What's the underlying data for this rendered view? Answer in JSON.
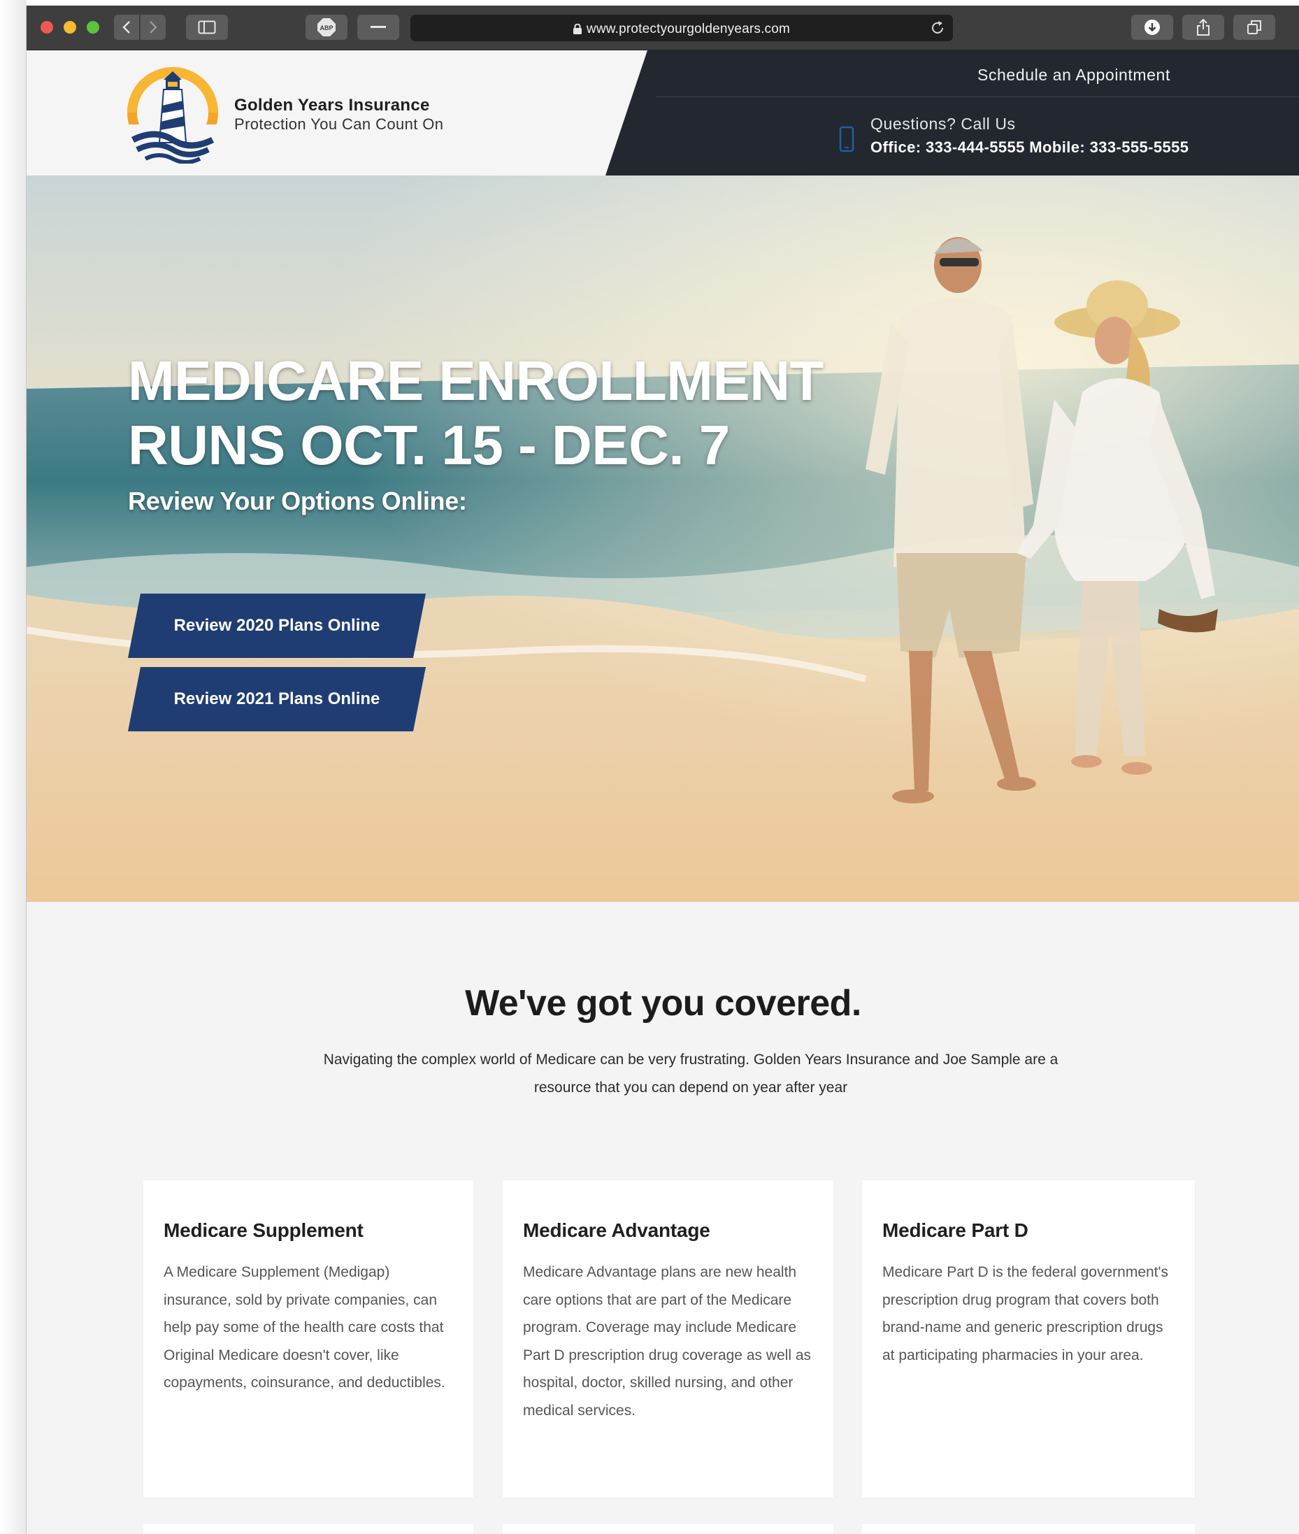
{
  "browser": {
    "url": "www.protectyourgoldenyears.com",
    "abp_label": "ABP"
  },
  "header": {
    "brand_name": "Golden Years Insurance",
    "brand_tagline": "Protection You Can Count On",
    "schedule_link": "Schedule an Appointment",
    "questions_label": "Questions? Call Us",
    "phones": "Office: 333-444-5555 Mobile: 333-555-5555"
  },
  "hero": {
    "title_line1": "MEDICARE ENROLLMENT",
    "title_line2": "RUNS OCT. 15 - DEC. 7",
    "subtitle": "Review Your Options Online:",
    "button_2020": "Review 2020 Plans Online",
    "button_2021": "Review 2021 Plans Online"
  },
  "covered": {
    "title": "We've got you covered.",
    "text": "Navigating the complex world of Medicare can be very frustrating. Golden Years Insurance and Joe Sample are a resource that you can depend on year after year"
  },
  "cards": [
    {
      "title": "Medicare Supplement",
      "text": "A Medicare Supplement (Medigap) insurance, sold by private companies, can help pay some of the health care costs that Original Medicare doesn't cover, like copayments, coinsurance, and deductibles."
    },
    {
      "title": "Medicare Advantage",
      "text": "Medicare Advantage plans are new health care options that are part of the Medicare program. Coverage may include Medicare Part D prescription drug coverage as well as hospital, doctor, skilled nursing, and other medical services."
    },
    {
      "title": "Medicare Part D",
      "text": "Medicare Part D is the federal government's prescription drug program that covers both brand-name and generic prescription drugs at participating pharmacies in your area."
    }
  ],
  "colors": {
    "header_dark": "#23272f",
    "button_blue": "#1f3d73",
    "page_bg": "#f4f4f4",
    "chrome_bg": "#3e3e3e"
  },
  "icons": [
    "back-icon",
    "forward-icon",
    "sidebar-icon",
    "abp-icon",
    "minus-icon",
    "lock-icon",
    "reload-icon",
    "download-icon",
    "share-icon",
    "tabs-icon",
    "phone-icon",
    "lighthouse-logo"
  ]
}
